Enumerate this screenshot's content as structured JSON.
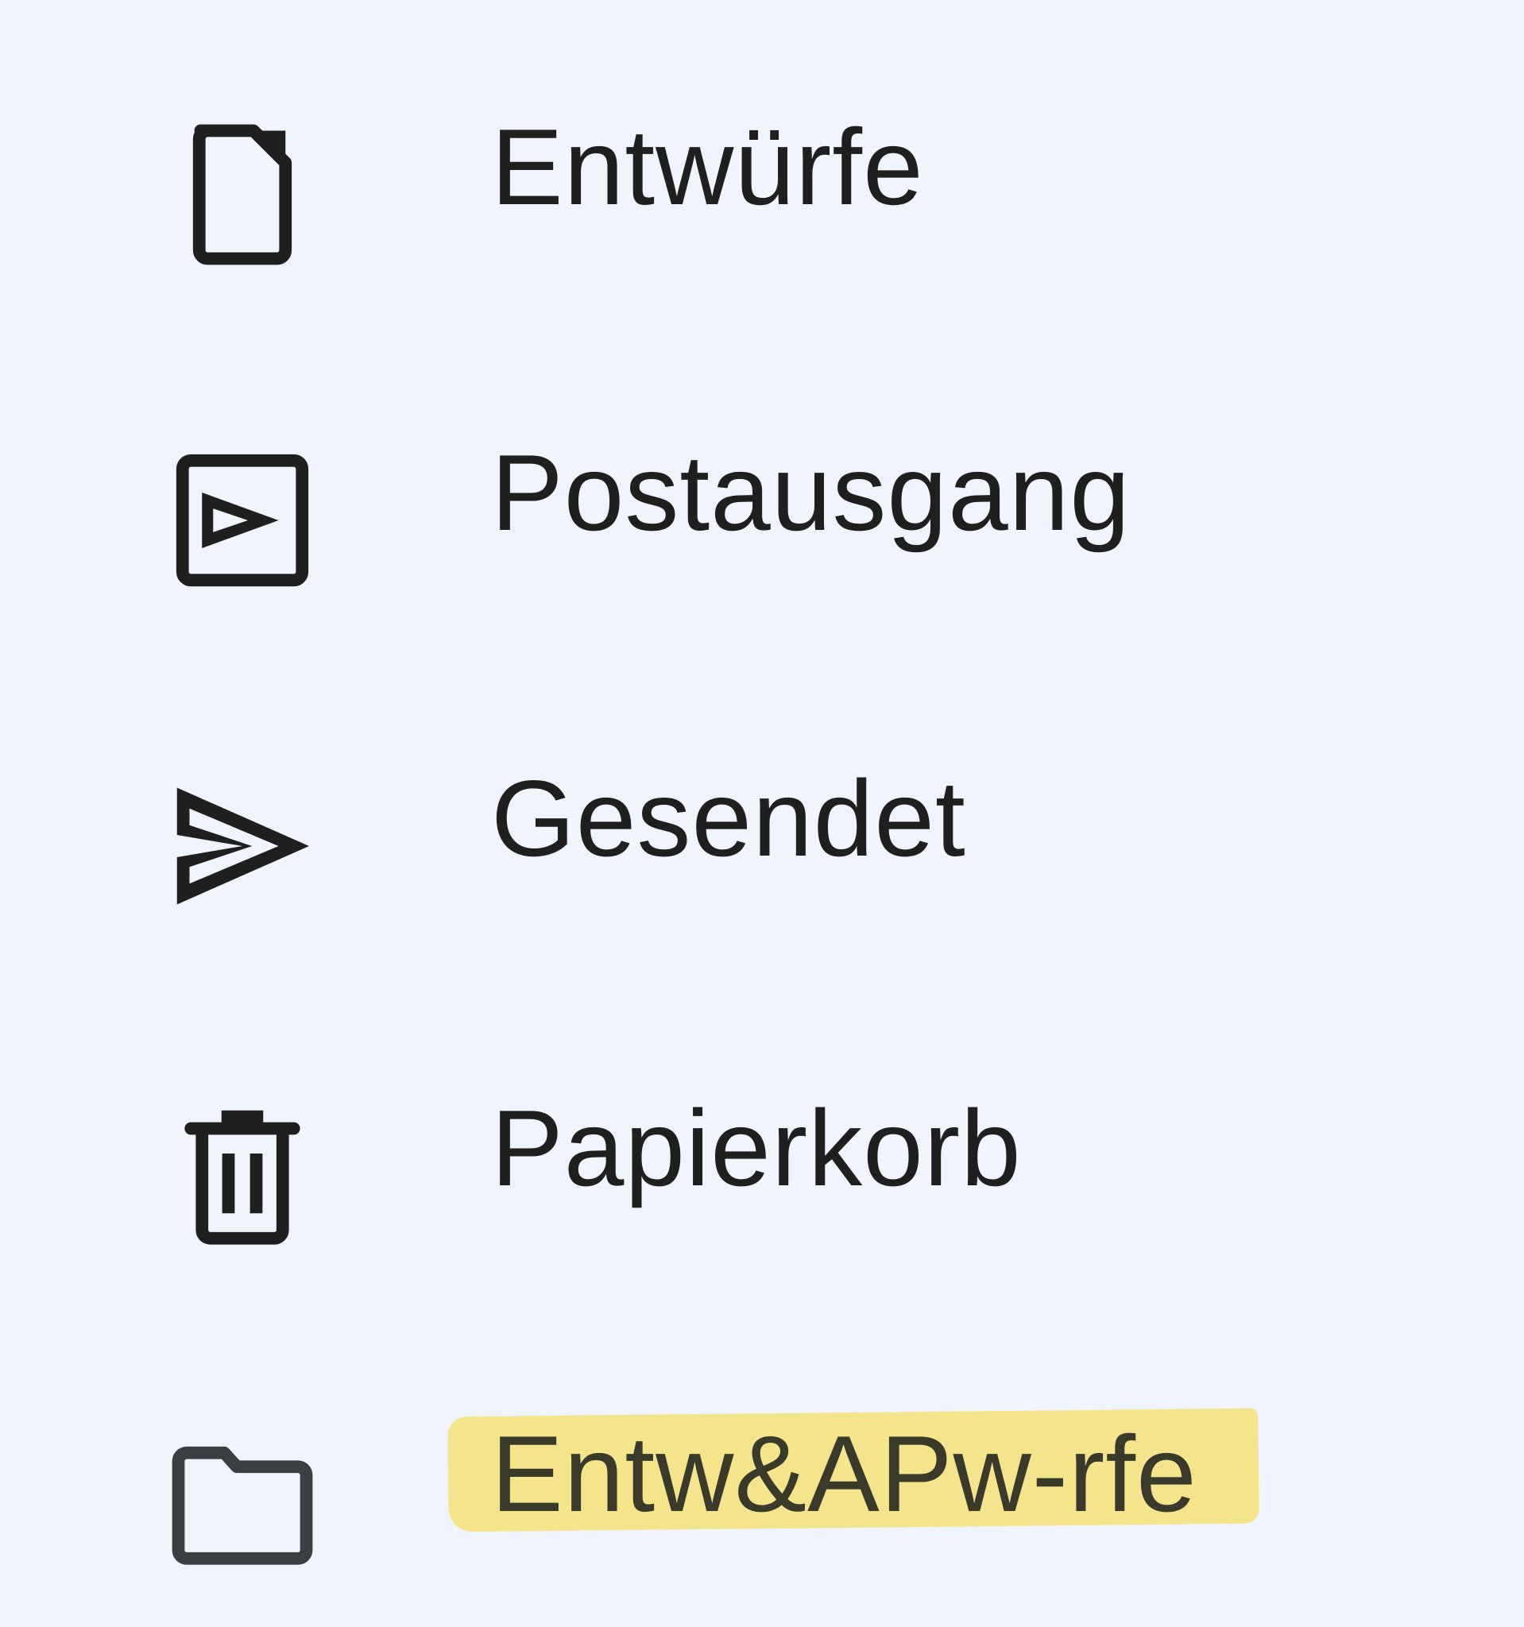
{
  "sidebar": {
    "items": [
      {
        "label": "Entwürfe",
        "icon": "draft-icon"
      },
      {
        "label": "Postausgang",
        "icon": "outbox-icon"
      },
      {
        "label": "Gesendet",
        "icon": "send-icon"
      },
      {
        "label": "Papierkorb",
        "icon": "trash-icon"
      },
      {
        "label": "Entw&APw-rfe",
        "icon": "folder-icon",
        "highlight_color": "#f5e278"
      }
    ]
  },
  "colors": {
    "background": "#f0f4fc",
    "text": "#1f1f1f",
    "icon": "#1f1f1f"
  }
}
